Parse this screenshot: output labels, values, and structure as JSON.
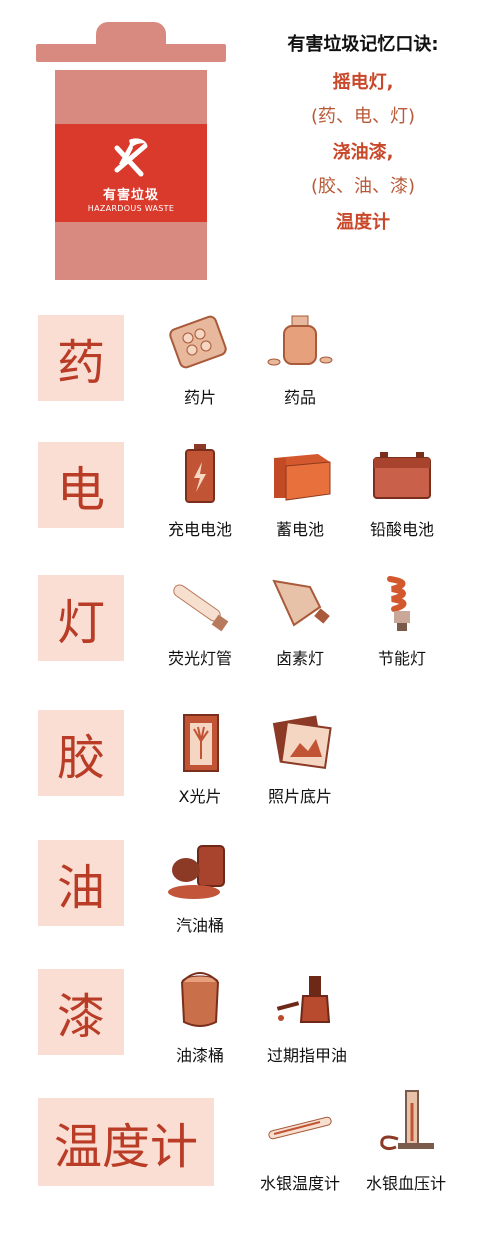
{
  "bin": {
    "label_cn": "有害垃圾",
    "label_en": "HAZARDOUS WASTE"
  },
  "rhyme": {
    "title": "有害垃圾记忆口诀:",
    "line1": "摇电灯,",
    "line1_note": "(药、电、灯)",
    "line2": "浇油漆,",
    "line2_note": "(胶、油、漆)",
    "line3": "温度计"
  },
  "categories": [
    {
      "char": "药",
      "items": [
        {
          "label": "药片",
          "icon": "pills-icon"
        },
        {
          "label": "药品",
          "icon": "medicine-bottle-icon"
        }
      ]
    },
    {
      "char": "电",
      "items": [
        {
          "label": "充电电池",
          "icon": "rechargeable-battery-icon"
        },
        {
          "label": "蓄电池",
          "icon": "storage-battery-icon"
        },
        {
          "label": "铅酸电池",
          "icon": "lead-acid-battery-icon"
        }
      ]
    },
    {
      "char": "灯",
      "items": [
        {
          "label": "荧光灯管",
          "icon": "fluorescent-tube-icon"
        },
        {
          "label": "卤素灯",
          "icon": "halogen-lamp-icon"
        },
        {
          "label": "节能灯",
          "icon": "energy-saving-bulb-icon"
        }
      ]
    },
    {
      "char": "胶",
      "items": [
        {
          "label": "X光片",
          "icon": "x-ray-film-icon"
        },
        {
          "label": "照片底片",
          "icon": "photo-negative-icon"
        }
      ]
    },
    {
      "char": "油",
      "items": [
        {
          "label": "汽油桶",
          "icon": "oil-barrel-icon"
        }
      ]
    },
    {
      "char": "漆",
      "items": [
        {
          "label": "油漆桶",
          "icon": "paint-bucket-icon"
        },
        {
          "label": "过期指甲油",
          "icon": "nail-polish-icon"
        }
      ]
    },
    {
      "char": "温度计",
      "items": [
        {
          "label": "水银温度计",
          "icon": "mercury-thermometer-icon"
        },
        {
          "label": "水银血压计",
          "icon": "mercury-sphygmomanometer-icon"
        }
      ]
    }
  ],
  "colors": {
    "accent": "#c9482a",
    "bin": "#d98a80",
    "bin_band": "#d93a2c",
    "category_bg": "#fbded3"
  }
}
